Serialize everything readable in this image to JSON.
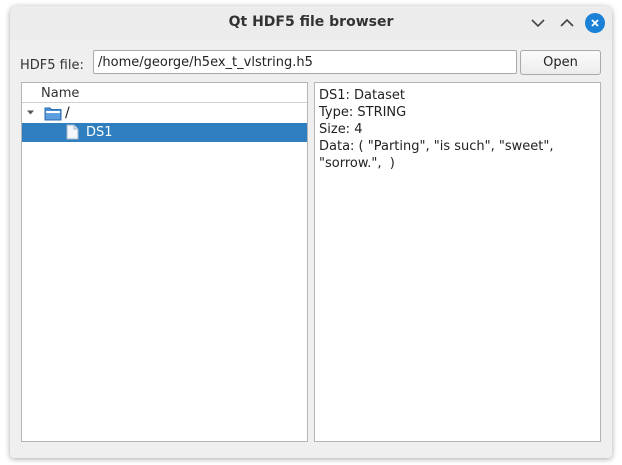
{
  "window": {
    "title": "Qt HDF5 file browser"
  },
  "titlebar_buttons": {
    "minimize_icon": "chevron-down-icon",
    "maximize_icon": "chevron-up-icon",
    "close_icon": "close-icon",
    "close_color": "#1a81d6"
  },
  "file_row": {
    "label": "HDF5 file:",
    "path_value": "/home/george/h5ex_t_vlstring.h5",
    "open_label": "Open"
  },
  "tree": {
    "header": "Name",
    "items": [
      {
        "label": "/",
        "icon": "folder-icon",
        "expanded": true,
        "selected": false
      },
      {
        "label": "DS1",
        "icon": "file-icon",
        "selected": true
      }
    ],
    "selection_color": "#2f7fc0"
  },
  "info": {
    "lines": [
      "DS1: Dataset",
      "Type: STRING",
      "Size: 4",
      "Data: ( \"Parting\", \"is such\", \"sweet\",",
      "\"sorrow.\",  )"
    ]
  }
}
